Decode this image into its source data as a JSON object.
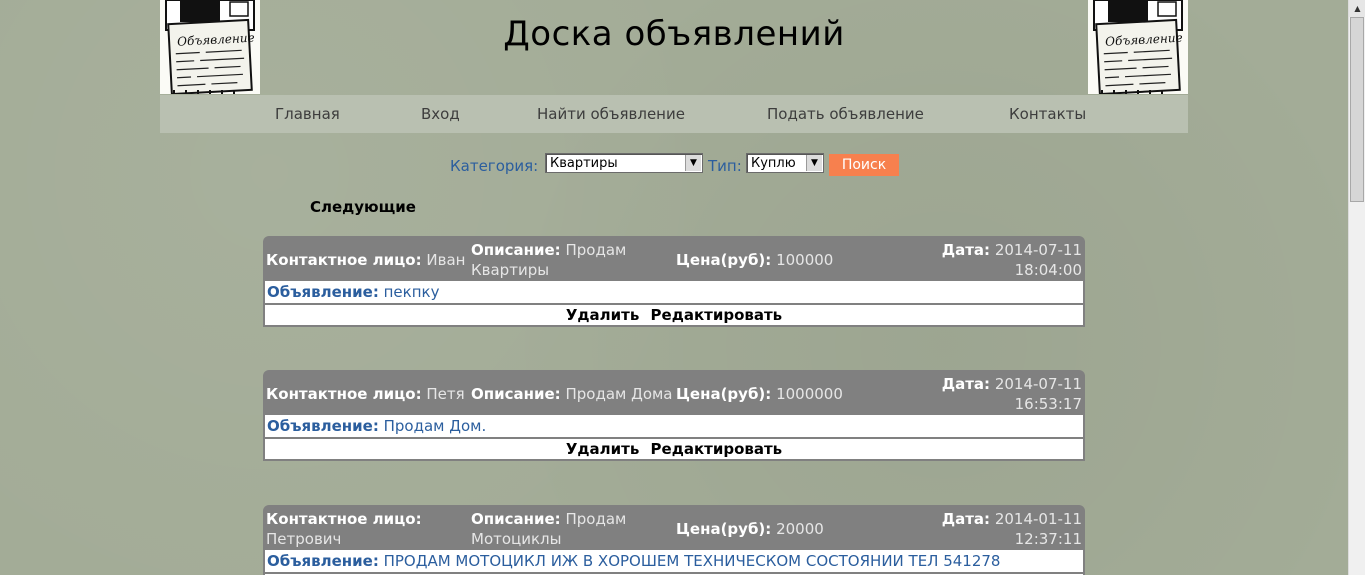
{
  "header": {
    "title": "Доска объявлений",
    "logo_text": "Объявление"
  },
  "nav": {
    "items": [
      {
        "label": "Главная"
      },
      {
        "label": "Вход"
      },
      {
        "label": "Найти объявление"
      },
      {
        "label": "Подать объявление"
      },
      {
        "label": "Контакты"
      }
    ]
  },
  "search": {
    "category_label": "Категория:",
    "category_value": "Квартиры",
    "type_label": "Тип:",
    "type_value": "Куплю",
    "button_label": "Поиск"
  },
  "section_title": "Следующие",
  "labels": {
    "contact": "Контактное лицо:",
    "description": "Описание:",
    "price": "Цена(руб):",
    "date": "Дата:",
    "ad": "Объявление:",
    "delete": "Удалить",
    "edit": "Редактировать"
  },
  "ads": [
    {
      "contact": "Иван",
      "description_1": "Продам",
      "description_2": "Квартиры",
      "price": "100000",
      "date": "2014-07-11",
      "time": "18:04:00",
      "text": "пекпку"
    },
    {
      "contact": "Петя",
      "description_1": "Продам Дома",
      "description_2": "",
      "price": "1000000",
      "date": "2014-07-11",
      "time": "16:53:17",
      "text": "Продам Дом."
    },
    {
      "contact": "Петрович",
      "description_1": "Продам",
      "description_2": "Мотоциклы",
      "price": "20000",
      "date": "2014-01-11",
      "time": "12:37:11",
      "text": "ПРОДАМ МОТОЦИКЛ ИЖ В ХОРОШЕМ ТЕХНИЧЕСКОМ СОСТОЯНИИ ТЕЛ 541278"
    }
  ],
  "colors": {
    "background": "#a3ac97",
    "nav_bg": "#b9c0b1",
    "link_blue": "#2b5e9e",
    "search_button": "#f7804e",
    "card_header": "#808080"
  }
}
